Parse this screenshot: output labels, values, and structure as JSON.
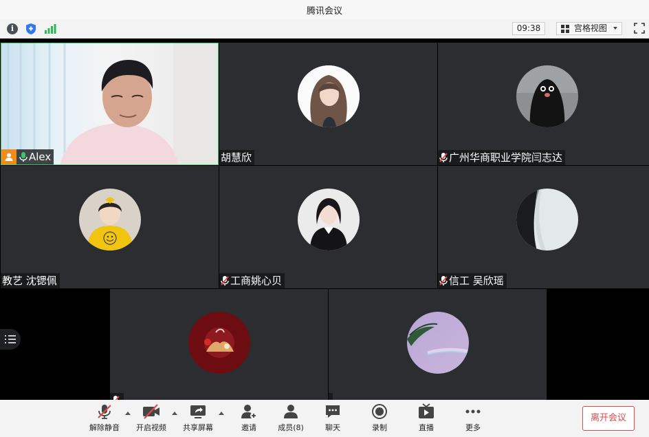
{
  "window": {
    "title": "腾讯会议"
  },
  "infobar": {
    "timer": "09:38",
    "view_mode": "宫格视图"
  },
  "participants": [
    {
      "name": "Alex",
      "has_video": true,
      "mic": "on",
      "host": true,
      "active_speaker": true
    },
    {
      "name": "胡慧欣",
      "has_video": false,
      "mic": "none"
    },
    {
      "name": "广州华商职业学院闫志达",
      "has_video": false,
      "mic": "muted"
    },
    {
      "name": "教艺 沈锶佩",
      "has_video": false,
      "mic": "none"
    },
    {
      "name": "工商姚心贝",
      "has_video": false,
      "mic": "muted"
    },
    {
      "name": "信工 吴欣瑶",
      "has_video": false,
      "mic": "muted"
    },
    {
      "name": "",
      "has_video": false,
      "mic": "muted"
    },
    {
      "name": "",
      "has_video": false,
      "mic": "none"
    }
  ],
  "toolbar": {
    "unmute": "解除静音",
    "start_video": "开启视频",
    "share_screen": "共享屏幕",
    "invite": "邀请",
    "members": "成员(8)",
    "chat": "聊天",
    "record": "录制",
    "live": "直播",
    "more": "更多",
    "leave": "离开会议"
  },
  "colors": {
    "accent_green": "#38c768",
    "leave_red": "#e04a4a",
    "tile_bg": "#2b2d31"
  }
}
